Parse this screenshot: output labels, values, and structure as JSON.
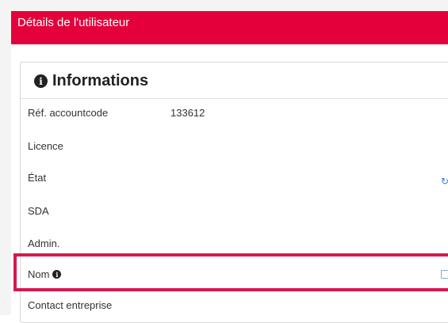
{
  "header": {
    "title": "Détails de l'utilisateur"
  },
  "panel": {
    "title": "Informations",
    "title_icon": "info-circle-icon"
  },
  "rows": [
    {
      "label": "Réf. accountcode",
      "value": "133612"
    },
    {
      "label": "Licence",
      "value": ""
    },
    {
      "label": "État",
      "value": ""
    },
    {
      "label": "SDA",
      "value": ""
    },
    {
      "label": "Admin.",
      "value": ""
    },
    {
      "label": "Nom",
      "value": ""
    },
    {
      "label": "Contact entreprise",
      "value": ""
    }
  ],
  "icons": {
    "state_action": "refresh-icon",
    "name_action": "edit-icon",
    "name_hint": "info-circle-icon"
  },
  "colors": {
    "brand": "#e4003b",
    "highlight": "#d4194f",
    "link": "#3a7bd5"
  }
}
